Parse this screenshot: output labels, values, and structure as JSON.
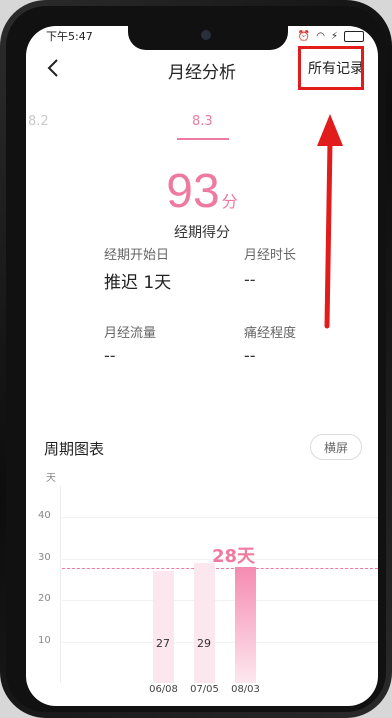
{
  "status": {
    "time": "下午5:47"
  },
  "header": {
    "title": "月经分析",
    "all_records": "所有记录"
  },
  "tabs": {
    "prev": "8.2",
    "current": "8.3"
  },
  "score": {
    "value": "93",
    "unit": "分",
    "label": "经期得分"
  },
  "info": {
    "start_label": "经期开始日",
    "start_value": "推迟 1天",
    "duration_label": "月经时长",
    "duration_value": "--",
    "flow_label": "月经流量",
    "flow_value": "--",
    "pain_label": "痛经程度",
    "pain_value": "--"
  },
  "cycle_chart": {
    "title": "周期图表",
    "landscape": "横屏"
  },
  "chart_data": {
    "type": "bar",
    "title": "周期图表",
    "ylabel": "天",
    "ylim": [
      0,
      50
    ],
    "yticks": [
      10,
      20,
      30,
      40
    ],
    "categories": [
      "06/08",
      "07/05",
      "08/03"
    ],
    "values": [
      27,
      29,
      28
    ],
    "value_labels": [
      "27",
      "29",
      ""
    ],
    "average": 28,
    "average_label": "28天",
    "highlight_index": 2
  },
  "colors": {
    "accent": "#ef7a9f",
    "annotation": "#e21b1b"
  }
}
